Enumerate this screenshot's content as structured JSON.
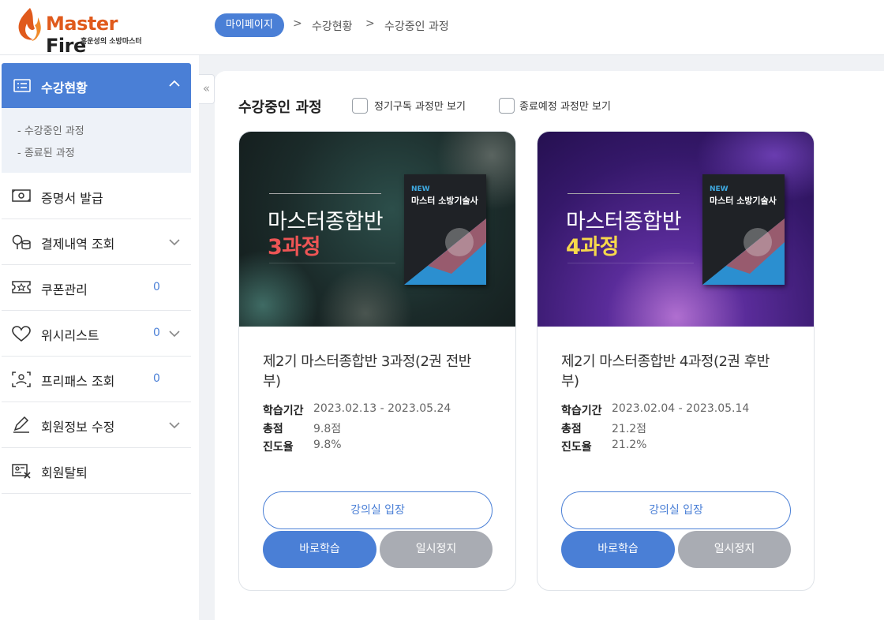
{
  "header": {
    "logo_brand_master": "Master",
    "logo_brand_fire": "Fire",
    "logo_tagline": "홍운성의 소방마스터",
    "breadcrumb": [
      "마이페이지",
      "수강현황",
      "수강중인 과정"
    ],
    "breadcrumb_separator": ">"
  },
  "sidebar": {
    "active": {
      "label": "수강현황",
      "icon": "list-icon"
    },
    "sub_items": [
      "- 수강중인 과정",
      "- 종료된 과정"
    ],
    "items": [
      {
        "label": "증명서 발급",
        "icon": "certificate-icon",
        "count": "",
        "chevron": false
      },
      {
        "label": "결제내역 조회",
        "icon": "payment-icon",
        "count": "",
        "chevron": true
      },
      {
        "label": "쿠폰관리",
        "icon": "coupon-icon",
        "count": "0",
        "chevron": false
      },
      {
        "label": "위시리스트",
        "icon": "heart-icon",
        "count": "0",
        "chevron": true
      },
      {
        "label": "프리패스 조회",
        "icon": "user-scan-icon",
        "count": "0",
        "chevron": false
      },
      {
        "label": "회원정보 수정",
        "icon": "pencil-icon",
        "count": "",
        "chevron": true
      },
      {
        "label": "회원탈퇴",
        "icon": "id-card-remove-icon",
        "count": "",
        "chevron": false
      }
    ],
    "collapse_glyph": "«"
  },
  "main": {
    "section_title": "수강중인 과정",
    "filters": [
      {
        "label": "정기구독 과정만 보기",
        "checked": false
      },
      {
        "label": "종료예정 과정만 보기",
        "checked": false
      }
    ],
    "courses": [
      {
        "banner_line1": "마스터종합반",
        "banner_line2": "3과정",
        "banner_theme": "green",
        "accent_color": "#ee5555",
        "book_new": "NEW",
        "book_title": "마스터 소방기술사",
        "title": "제2기 마스터종합반 3과정(2권 전반부)",
        "meta": [
          {
            "key": "학습기간",
            "value": "2023.02.13 - 2023.05.24"
          },
          {
            "key": "총점",
            "value": "9.8점"
          },
          {
            "key": "진도율",
            "value": "9.8%"
          }
        ],
        "btn_enter": "강의실 입장",
        "btn_study": "바로학습",
        "btn_pause": "일시정지"
      },
      {
        "banner_line1": "마스터종합반",
        "banner_line2": "4과정",
        "banner_theme": "purple",
        "accent_color": "#f7d84b",
        "book_new": "NEW",
        "book_title": "마스터 소방기술사",
        "title": "제2기 마스터종합반 4과정(2권 후반부)",
        "meta": [
          {
            "key": "학습기간",
            "value": "2023.02.04 - 2023.05.14"
          },
          {
            "key": "총점",
            "value": "21.2점"
          },
          {
            "key": "진도율",
            "value": "21.2%"
          }
        ],
        "btn_enter": "강의실 입장",
        "btn_study": "바로학습",
        "btn_pause": "일시정지"
      }
    ]
  },
  "colors": {
    "primary": "#4a7fd6",
    "muted_button": "#a9acb3",
    "brand_orange": "#e05a1c"
  }
}
